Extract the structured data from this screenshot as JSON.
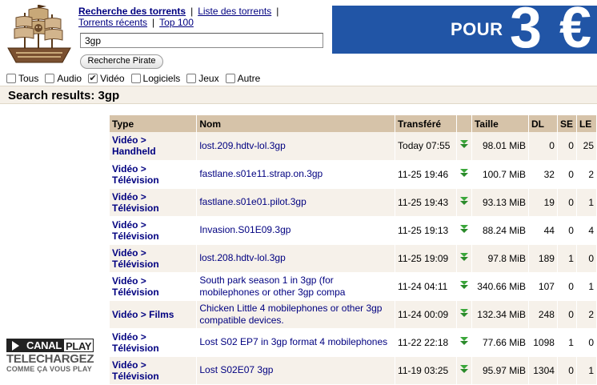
{
  "nav": {
    "search_link": "Recherche des torrents",
    "list_link": "Liste des torrents",
    "recent_link": "Torrents récents",
    "top_link": "Top 100",
    "separator": "|"
  },
  "search": {
    "value": "3gp",
    "button_label": "Recherche Pirate"
  },
  "categories": [
    {
      "label": "Tous",
      "checked": false
    },
    {
      "label": "Audio",
      "checked": false
    },
    {
      "label": "Vidéo",
      "checked": true
    },
    {
      "label": "Logiciels",
      "checked": false
    },
    {
      "label": "Jeux",
      "checked": false
    },
    {
      "label": "Autre",
      "checked": false
    }
  ],
  "banner": {
    "text": "POUR",
    "price": "3 €"
  },
  "results": {
    "title": "Search results: 3gp"
  },
  "table": {
    "headers": [
      "Type",
      "Nom",
      "Transféré",
      "",
      "Taille",
      "DL",
      "SE",
      "LE"
    ],
    "rows": [
      {
        "type1": "Vidéo >",
        "type2": "Handheld",
        "name": "lost.209.hdtv-lol.3gp",
        "date": "Today 07:55",
        "size": "98.01 MiB",
        "dl": "0",
        "se": "0",
        "le": "25"
      },
      {
        "type1": "Vidéo >",
        "type2": "Télévision",
        "name": "fastlane.s01e11.strap.on.3gp",
        "date": "11-25 19:46",
        "size": "100.7 MiB",
        "dl": "32",
        "se": "0",
        "le": "2"
      },
      {
        "type1": "Vidéo >",
        "type2": "Télévision",
        "name": "fastlane.s01e01.pilot.3gp",
        "date": "11-25 19:43",
        "size": "93.13 MiB",
        "dl": "19",
        "se": "0",
        "le": "1"
      },
      {
        "type1": "Vidéo >",
        "type2": "Télévision",
        "name": "Invasion.S01E09.3gp",
        "date": "11-25 19:13",
        "size": "88.24 MiB",
        "dl": "44",
        "se": "0",
        "le": "4"
      },
      {
        "type1": "Vidéo >",
        "type2": "Télévision",
        "name": "lost.208.hdtv-lol.3gp",
        "date": "11-25 19:09",
        "size": "97.8 MiB",
        "dl": "189",
        "se": "1",
        "le": "0"
      },
      {
        "type1": "Vidéo >",
        "type2": "Télévision",
        "name": "South park season 1 in 3gp (for mobilephones or other 3gp compa",
        "date": "11-24 04:11",
        "size": "340.66 MiB",
        "dl": "107",
        "se": "0",
        "le": "1"
      },
      {
        "type1": "Vidéo > Films",
        "type2": "",
        "name": "Chicken Little 4 mobilephones or other 3gp compatible devices.",
        "date": "11-24 00:09",
        "size": "132.34 MiB",
        "dl": "248",
        "se": "0",
        "le": "2"
      },
      {
        "type1": "Vidéo >",
        "type2": "Télévision",
        "name": "Lost S02 EP7 in 3gp format 4 mobilephones",
        "date": "11-22 22:18",
        "size": "77.66 MiB",
        "dl": "1098",
        "se": "1",
        "le": "0"
      },
      {
        "type1": "Vidéo >",
        "type2": "Télévision",
        "name": "Lost S02E07 3gp",
        "date": "11-19 03:25",
        "size": "95.97 MiB",
        "dl": "1304",
        "se": "0",
        "le": "1"
      }
    ]
  },
  "canal_ad": {
    "brand_a": "CANAL",
    "brand_b": "PLAY",
    "line2": "TELECHARGEZ",
    "line3": "COMME ÇA VOUS PLAY"
  }
}
